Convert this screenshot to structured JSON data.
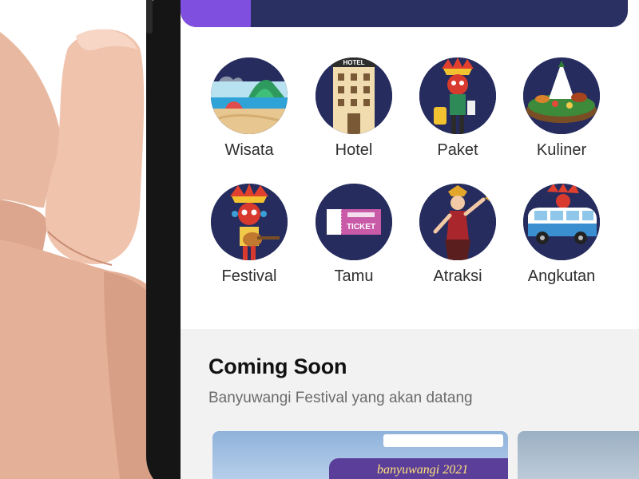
{
  "categories": [
    {
      "label": "Wisata",
      "icon": "beach-island-icon"
    },
    {
      "label": "Hotel",
      "icon": "hotel-building-icon"
    },
    {
      "label": "Paket",
      "icon": "traveler-mascot-icon"
    },
    {
      "label": "Kuliner",
      "icon": "tumpeng-food-icon"
    },
    {
      "label": "Festival",
      "icon": "gandrung-guitar-mascot-icon"
    },
    {
      "label": "Tamu",
      "icon": "ticket-icon"
    },
    {
      "label": "Atraksi",
      "icon": "dancer-icon"
    },
    {
      "label": "Angkutan",
      "icon": "van-icon"
    }
  ],
  "hotel_sign": "HOTEL",
  "ticket_text": "TICKET",
  "coming_soon": {
    "title": "Coming Soon",
    "subtitle": "Banyuwangi Festival yang akan datang",
    "card_brand": "banyuwangi 2021"
  },
  "colors": {
    "icon_bg": "#262c5e",
    "banner": "#2b3062",
    "banner_accent": "#7f4fe0",
    "section_bg": "#f2f2f2"
  }
}
